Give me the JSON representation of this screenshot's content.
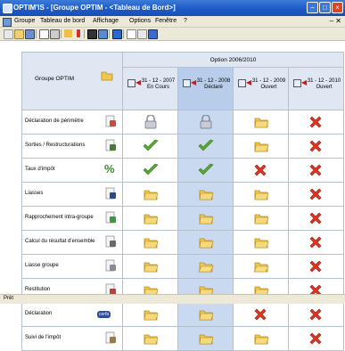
{
  "window": {
    "title": "OPTIM'IS - [Groupe OPTIM - <Tableau de Bord>]"
  },
  "menu": [
    "Groupe",
    "Tableau de bord",
    "Affichage",
    "Options",
    "Fenêtre",
    "?"
  ],
  "corner_label": "Groupe OPTIM",
  "option_header": "Option 2006/2010",
  "columns": [
    {
      "date": "31 - 12 - 2007",
      "status": "En Cours"
    },
    {
      "date": "31 - 12 - 2008",
      "status": "Déclaré"
    },
    {
      "date": "31 - 12 - 2009",
      "status": "Ouvert"
    },
    {
      "date": "31 - 12 - 2010",
      "status": "Ouvert"
    }
  ],
  "rows": [
    {
      "label": "Déclaration de périmètre",
      "icon": "document-icon",
      "cells": [
        "lock",
        "lock",
        "folder",
        "cross"
      ]
    },
    {
      "label": "Sorties / Restructurations",
      "icon": "restructure-icon",
      "cells": [
        "check",
        "check",
        "folder",
        "cross"
      ]
    },
    {
      "label": "Taux d'impôt",
      "icon": "percent-icon",
      "cells": [
        "check",
        "check",
        "cross",
        "cross"
      ]
    },
    {
      "label": "Liasses",
      "icon": "pen-icon",
      "cells": [
        "folder",
        "folder",
        "folder",
        "cross"
      ]
    },
    {
      "label": "Rapprochement intra-groupe",
      "icon": "sync-icon",
      "cells": [
        "folder",
        "folder",
        "folder",
        "cross"
      ]
    },
    {
      "label": "Calcul du résultat d'ensemble",
      "icon": "gear-icon",
      "cells": [
        "folder",
        "folder",
        "folder",
        "cross"
      ]
    },
    {
      "label": "Liasse groupe",
      "icon": "doc-stack-icon",
      "cells": [
        "folder",
        "folder-open",
        "folder-open",
        "cross"
      ]
    },
    {
      "label": "Restitution",
      "icon": "report-icon",
      "cells": [
        "folder",
        "folder",
        "folder",
        "cross"
      ]
    },
    {
      "label": "Déclaration",
      "icon": "cerfa-icon",
      "cells": [
        "folder",
        "folder",
        "cross",
        "cross"
      ]
    },
    {
      "label": "Suivi de l'impôt",
      "icon": "tax-follow-icon",
      "cells": [
        "folder",
        "folder",
        "folder",
        "cross"
      ]
    }
  ],
  "status_bar": "Prêt",
  "colors": {
    "title_bar": "#1c5ac8",
    "check": "#5aa832",
    "cross": "#e0341f",
    "folder": "#f2c84b",
    "header_bg": "#dfe7f3",
    "selected_col": "#c8d9f0"
  }
}
